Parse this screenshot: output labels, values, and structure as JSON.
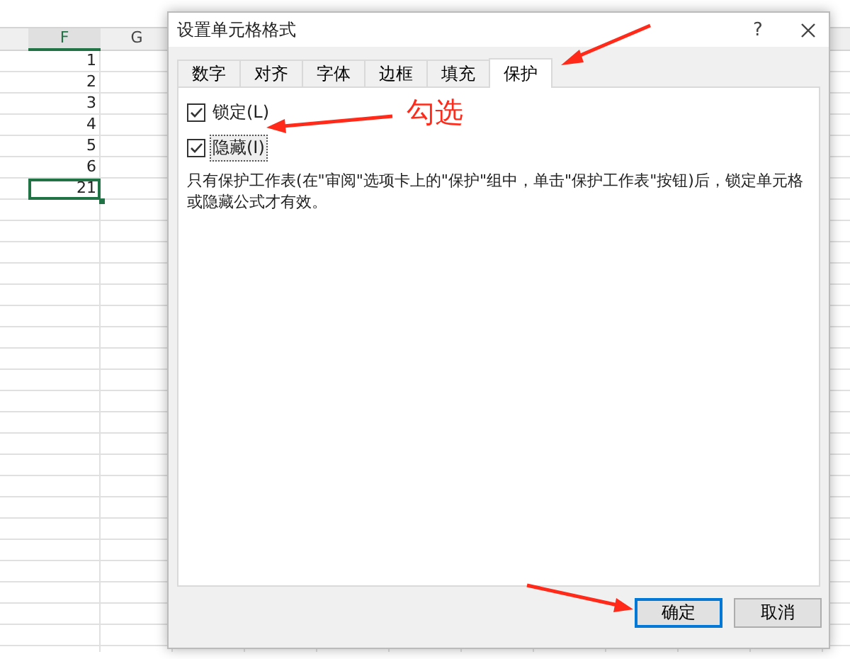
{
  "sheet": {
    "columns": [
      {
        "label": "F",
        "selected": true
      },
      {
        "label": "G",
        "selected": false
      }
    ],
    "cells": [
      {
        "value": "1",
        "selected": false
      },
      {
        "value": "2",
        "selected": false
      },
      {
        "value": "3",
        "selected": false
      },
      {
        "value": "4",
        "selected": false
      },
      {
        "value": "5",
        "selected": false
      },
      {
        "value": "6",
        "selected": false
      },
      {
        "value": "21",
        "selected": true
      }
    ]
  },
  "dialog": {
    "title": "设置单元格格式",
    "help": "?",
    "tabs": [
      {
        "label": "数字",
        "selected": false
      },
      {
        "label": "对齐",
        "selected": false
      },
      {
        "label": "字体",
        "selected": false
      },
      {
        "label": "边框",
        "selected": false
      },
      {
        "label": "填充",
        "selected": false
      },
      {
        "label": "保护",
        "selected": true
      }
    ],
    "options": [
      {
        "label": "锁定(L)",
        "checked": true,
        "focused": false
      },
      {
        "label": "隐藏(I)",
        "checked": true,
        "focused": true
      }
    ],
    "note": "只有保护工作表(在\"审阅\"选项卡上的\"保护\"组中，单击\"保护工作表\"按钮)后，锁定单元格或隐藏公式才有效。",
    "buttons": [
      {
        "label": "确定",
        "default": true
      },
      {
        "label": "取消",
        "default": false
      }
    ]
  },
  "annotation": {
    "text": "勾选"
  }
}
